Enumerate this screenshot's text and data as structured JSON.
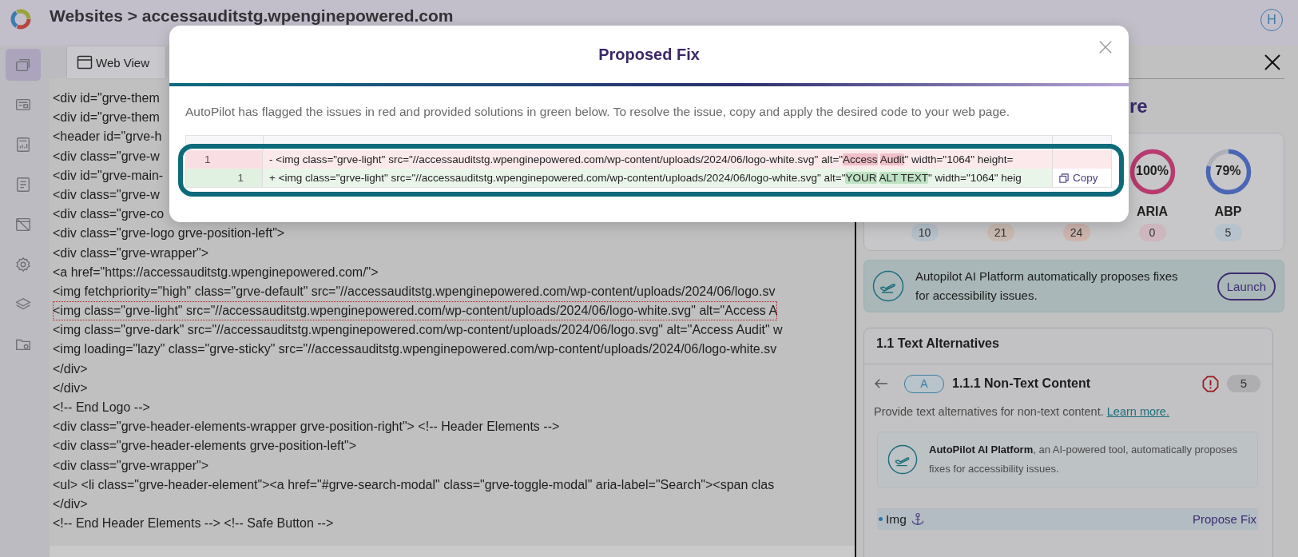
{
  "header": {
    "title": "Websites > accessauditstg.wpenginepowered.com",
    "avatar": "H"
  },
  "sidebar": {
    "items": [
      {
        "selected": true
      },
      {
        "selected": false
      },
      {
        "selected": false
      },
      {
        "selected": false
      },
      {
        "selected": false
      },
      {
        "selected": false
      },
      {
        "selected": false
      },
      {
        "selected": false
      }
    ]
  },
  "toolbar": {
    "tabs": [
      {
        "label": "Web View",
        "selected": true
      }
    ]
  },
  "code": {
    "lines": [
      {
        "text": "<div id=\"grve-them",
        "flagged": false
      },
      {
        "text": "<div id=\"grve-them",
        "flagged": false
      },
      {
        "text": "<header id=\"grve-h",
        "flagged": false
      },
      {
        "text": "<div class=\"grve-w",
        "flagged": false
      },
      {
        "text": "<div id=\"grve-main-",
        "flagged": false
      },
      {
        "text": "<div class=\"grve-w",
        "flagged": false
      },
      {
        "text": "<div class=\"grve-co",
        "flagged": false
      },
      {
        "text": "<div class=\"grve-logo grve-position-left\">",
        "flagged": false
      },
      {
        "text": "<div class=\"grve-wrapper\">",
        "flagged": false
      },
      {
        "text": "<a href=\"https://accessauditstg.wpenginepowered.com/\">",
        "flagged": false
      },
      {
        "text": "<img fetchpriority=\"high\" class=\"grve-default\" src=\"//accessauditstg.wpenginepowered.com/wp-content/uploads/2024/06/logo.sv",
        "flagged": false
      },
      {
        "text": "<img class=\"grve-light\" src=\"//accessauditstg.wpenginepowered.com/wp-content/uploads/2024/06/logo-white.svg\" alt=\"Access A",
        "flagged": true
      },
      {
        "text": "<img class=\"grve-dark\" src=\"//accessauditstg.wpenginepowered.com/wp-content/uploads/2024/06/logo.svg\" alt=\"Access Audit\" w",
        "flagged": false
      },
      {
        "text": "<img loading=\"lazy\" class=\"grve-sticky\" src=\"//accessauditstg.wpenginepowered.com/wp-content/uploads/2024/06/logo-white.sv",
        "flagged": false
      },
      {
        "text": "</div>",
        "flagged": false
      },
      {
        "text": "</div>",
        "flagged": false
      },
      {
        "text": "<!-- End Logo -->",
        "flagged": false
      },
      {
        "text": "<div class=\"grve-header-elements-wrapper grve-position-right\"> <!-- Header Elements -->",
        "flagged": false
      },
      {
        "text": "<div class=\"grve-header-elements grve-position-left\">",
        "flagged": false
      },
      {
        "text": "<div class=\"grve-wrapper\">",
        "flagged": false
      },
      {
        "text": "<ul> <li class=\"grve-header-element\"><a href=\"#grve-search-modal\" class=\"grve-toggle-modal\" aria-label=\"Search\"><span clas",
        "flagged": false
      },
      {
        "text": "</div>",
        "flagged": false
      },
      {
        "text": "<!-- End Header Elements --> <!-- Safe Button -->",
        "flagged": false
      }
    ]
  },
  "panel": {
    "heading": "re",
    "scores": [
      {
        "count": "10",
        "color": "#b5c0c9"
      },
      {
        "count": "21",
        "color": "#c9bab1"
      },
      {
        "count": "24",
        "color": "#cdb5ae"
      },
      {
        "label": "ARIA",
        "count": "0",
        "color": "#cdb6be",
        "ring": {
          "value": "100%",
          "level": 1,
          "color": "#b83a6e"
        }
      },
      {
        "label": "ABP",
        "count": "5",
        "color": "#b7c3cc",
        "ring": {
          "value": "79%",
          "level": 0.79,
          "color": "#4a66b5"
        }
      }
    ],
    "banner": {
      "text": "Autopilot AI Platform automatically proposes fixes for accessibility issues.",
      "button": "Launch"
    },
    "section": {
      "title": "1.1 Text Alternatives",
      "criterion": {
        "grade": "A",
        "title": "1.1.1 Non-Text Content",
        "count": "5"
      },
      "description": "Provide text alternatives for non-text content.",
      "link": "Learn more.",
      "note": "**AutoPilot AI Platform**, an AI-powered tool, automatically proposes fixes for accessibility issues.",
      "item": {
        "label": "Img",
        "action": "Propose Fix"
      }
    }
  },
  "modal": {
    "title": "Proposed Fix",
    "description": "AutoPilot has flagged the issues in red and provided solutions in green below. To resolve the issue, copy and apply the desired code to your web page.",
    "diff": {
      "copy": "Copy",
      "rows": [
        {
          "kind": "removed",
          "number": "1",
          "segments": [
            {
              "text": "- <img class=\"grve-light\" src=\"//accessauditstg.wpenginepowered.com/wp-content/uploads/2024/06/logo-white.svg\" alt=\"",
              "changed": false
            },
            {
              "text": "Access ",
              "changed": true
            },
            {
              "text": "Audit",
              "changed": true
            },
            {
              "text": "\" width=\"1064\" height=",
              "changed": false
            }
          ]
        },
        {
          "kind": "added",
          "number": "1",
          "segments": [
            {
              "text": "+ <img class=\"grve-light\" src=\"//accessauditstg.wpenginepowered.com/wp-content/uploads/2024/06/logo-white.svg\" alt=\"",
              "changed": false
            },
            {
              "text": "YOUR ",
              "changed": true
            },
            {
              "text": "ALT TEXT",
              "changed": true
            },
            {
              "text": "\" width=\"1064\" heig",
              "changed": false
            }
          ]
        }
      ]
    }
  }
}
